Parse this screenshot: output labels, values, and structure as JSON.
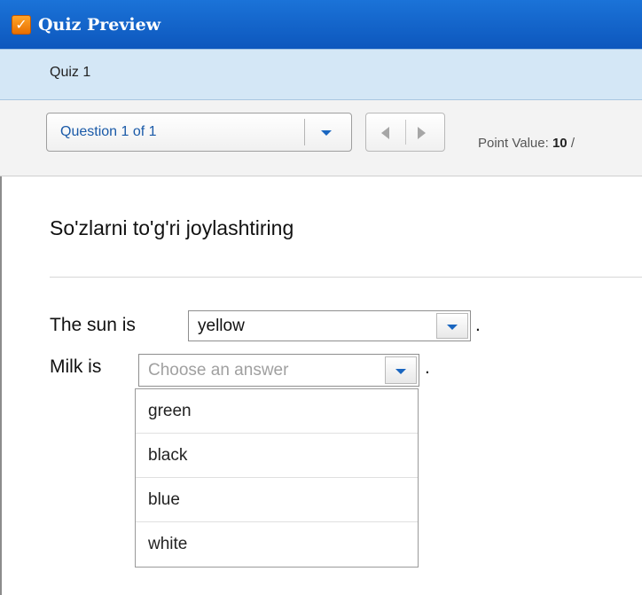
{
  "window": {
    "title": "Quiz Preview",
    "icon": "v-logo-icon"
  },
  "quiz": {
    "name": "Quiz 1"
  },
  "toolbar": {
    "question_selector": "Question 1 of 1",
    "point_label": "Point Value:",
    "point_value": "10",
    "point_suffix": "/"
  },
  "question": {
    "prompt": "So'zlarni to'g'ri joylashtiring",
    "rows": [
      {
        "label": "The sun is",
        "value": "yellow",
        "placeholder": "",
        "end": "."
      },
      {
        "label": "Milk is",
        "value": "",
        "placeholder": "Choose an answer",
        "end": "."
      }
    ],
    "open_dropdown_options": [
      "green",
      "black",
      "blue",
      "white"
    ]
  },
  "colors": {
    "titlebar": "#1b73d8",
    "subbar": "#d4e7f6",
    "accent": "#1a66c0"
  }
}
